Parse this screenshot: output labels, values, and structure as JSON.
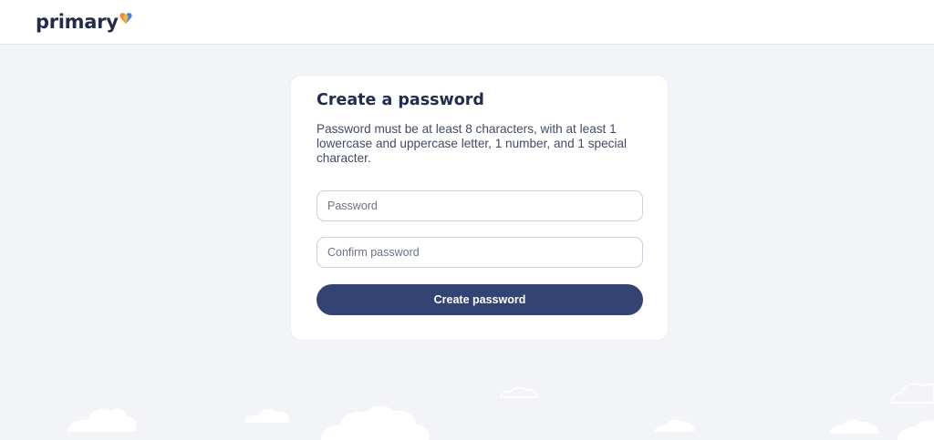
{
  "header": {
    "logo_text": "primary",
    "logo_icon": "heart-logo-icon",
    "brand_colors": {
      "orange": "#f08a2c",
      "blue": "#4a7ee0",
      "gold": "#f4b83a"
    }
  },
  "card": {
    "title": "Create a password",
    "description": "Password must be at least 8 characters, with at least 1 lowercase and uppercase letter, 1 number, and 1 special character.",
    "password_field": {
      "placeholder": "Password",
      "value": ""
    },
    "confirm_field": {
      "placeholder": "Confirm password",
      "value": ""
    },
    "submit_label": "Create password"
  },
  "colors": {
    "page_background": "#f3f4f8",
    "primary_button": "#334474",
    "heading_text": "#232c4e"
  }
}
